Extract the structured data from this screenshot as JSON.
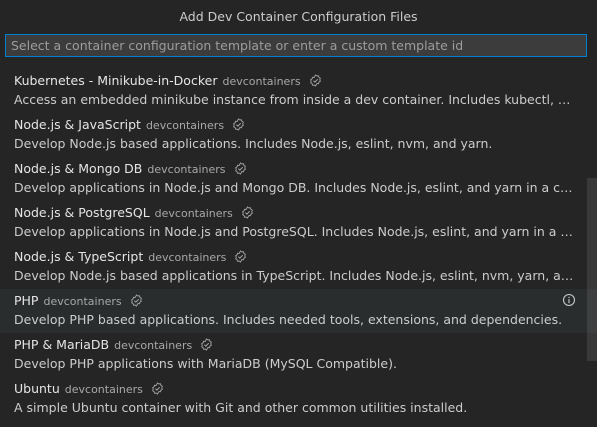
{
  "title": "Add Dev Container Configuration Files",
  "input": {
    "value": "",
    "placeholder": "Select a container configuration template or enter a custom template id"
  },
  "items": [
    {
      "name": "Kubernetes - Minikube-in-Docker",
      "source": "devcontainers",
      "description": "Access an embedded minikube instance from inside a dev container. Includes kubectl, Helm, mi…"
    },
    {
      "name": "Node.js & JavaScript",
      "source": "devcontainers",
      "description": "Develop Node.js based applications. Includes Node.js, eslint, nvm, and yarn."
    },
    {
      "name": "Node.js & Mongo DB",
      "source": "devcontainers",
      "description": "Develop applications in Node.js and Mongo DB. Includes Node.js, eslint, and yarn in a container…"
    },
    {
      "name": "Node.js & PostgreSQL",
      "source": "devcontainers",
      "description": "Develop applications in Node.js and PostgreSQL. Includes Node.js, eslint, and yarn in a contain…"
    },
    {
      "name": "Node.js & TypeScript",
      "source": "devcontainers",
      "description": "Develop Node.js based applications in TypeScript. Includes Node.js, eslint, nvm, yarn, and the T…"
    },
    {
      "name": "PHP",
      "source": "devcontainers",
      "description": "Develop PHP based applications. Includes needed tools, extensions, and dependencies."
    },
    {
      "name": "PHP & MariaDB",
      "source": "devcontainers",
      "description": "Develop PHP applications with MariaDB (MySQL Compatible)."
    },
    {
      "name": "Ubuntu",
      "source": "devcontainers",
      "description": "A simple Ubuntu container with Git and other common utilities installed."
    }
  ],
  "icons": {
    "verified": "verified-icon",
    "info": "info-icon"
  },
  "colors": {
    "background": "#252526",
    "focus_border": "#007fd4",
    "selected_row": "#2a2d2e"
  }
}
